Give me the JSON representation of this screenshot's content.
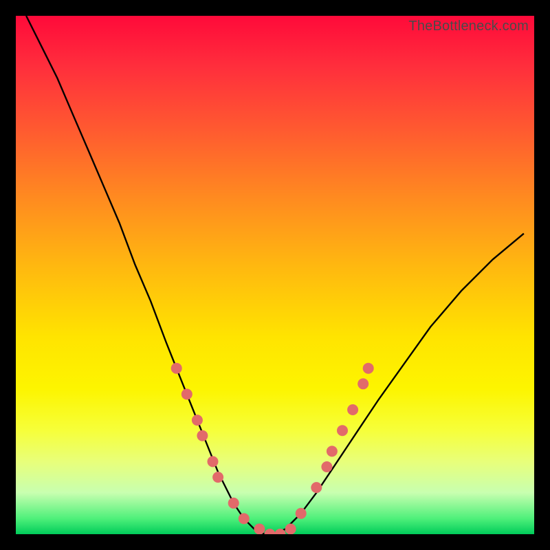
{
  "watermark": "TheBottleneck.com",
  "chart_data": {
    "type": "line",
    "title": "",
    "xlabel": "",
    "ylabel": "",
    "xlim": [
      0,
      100
    ],
    "ylim": [
      0,
      100
    ],
    "series": [
      {
        "name": "bottleneck-curve",
        "color": "#000000",
        "x": [
          2,
          5,
          8,
          11,
          14,
          17,
          20,
          23,
          26,
          29,
          31,
          33,
          35,
          37,
          39,
          40,
          42,
          44,
          46,
          48,
          50,
          52,
          55,
          58,
          62,
          66,
          70,
          75,
          80,
          86,
          92,
          98
        ],
        "values": [
          100,
          94,
          88,
          81,
          74,
          67,
          60,
          52,
          45,
          37,
          32,
          27,
          22,
          17,
          12,
          10,
          6,
          3,
          1,
          0,
          0,
          1,
          4,
          8,
          14,
          20,
          26,
          33,
          40,
          47,
          53,
          58
        ]
      }
    ],
    "markers": {
      "name": "highlight-points",
      "color": "#e26a6a",
      "radius": 8,
      "points": [
        {
          "x": 31,
          "y": 32
        },
        {
          "x": 33,
          "y": 27
        },
        {
          "x": 35,
          "y": 22
        },
        {
          "x": 36,
          "y": 19
        },
        {
          "x": 38,
          "y": 14
        },
        {
          "x": 39,
          "y": 11
        },
        {
          "x": 42,
          "y": 6
        },
        {
          "x": 44,
          "y": 3
        },
        {
          "x": 47,
          "y": 1
        },
        {
          "x": 49,
          "y": 0
        },
        {
          "x": 51,
          "y": 0
        },
        {
          "x": 53,
          "y": 1
        },
        {
          "x": 55,
          "y": 4
        },
        {
          "x": 58,
          "y": 9
        },
        {
          "x": 60,
          "y": 13
        },
        {
          "x": 61,
          "y": 16
        },
        {
          "x": 63,
          "y": 20
        },
        {
          "x": 65,
          "y": 24
        },
        {
          "x": 67,
          "y": 29
        },
        {
          "x": 68,
          "y": 32
        }
      ]
    },
    "gradient_bands": {
      "description": "vertical gradient from red (top, high bottleneck) to green (bottom, zero bottleneck)",
      "stops": [
        {
          "pos": 0,
          "color": "#ff0a3a"
        },
        {
          "pos": 50,
          "color": "#ffd400"
        },
        {
          "pos": 100,
          "color": "#00cc5a"
        }
      ]
    }
  }
}
